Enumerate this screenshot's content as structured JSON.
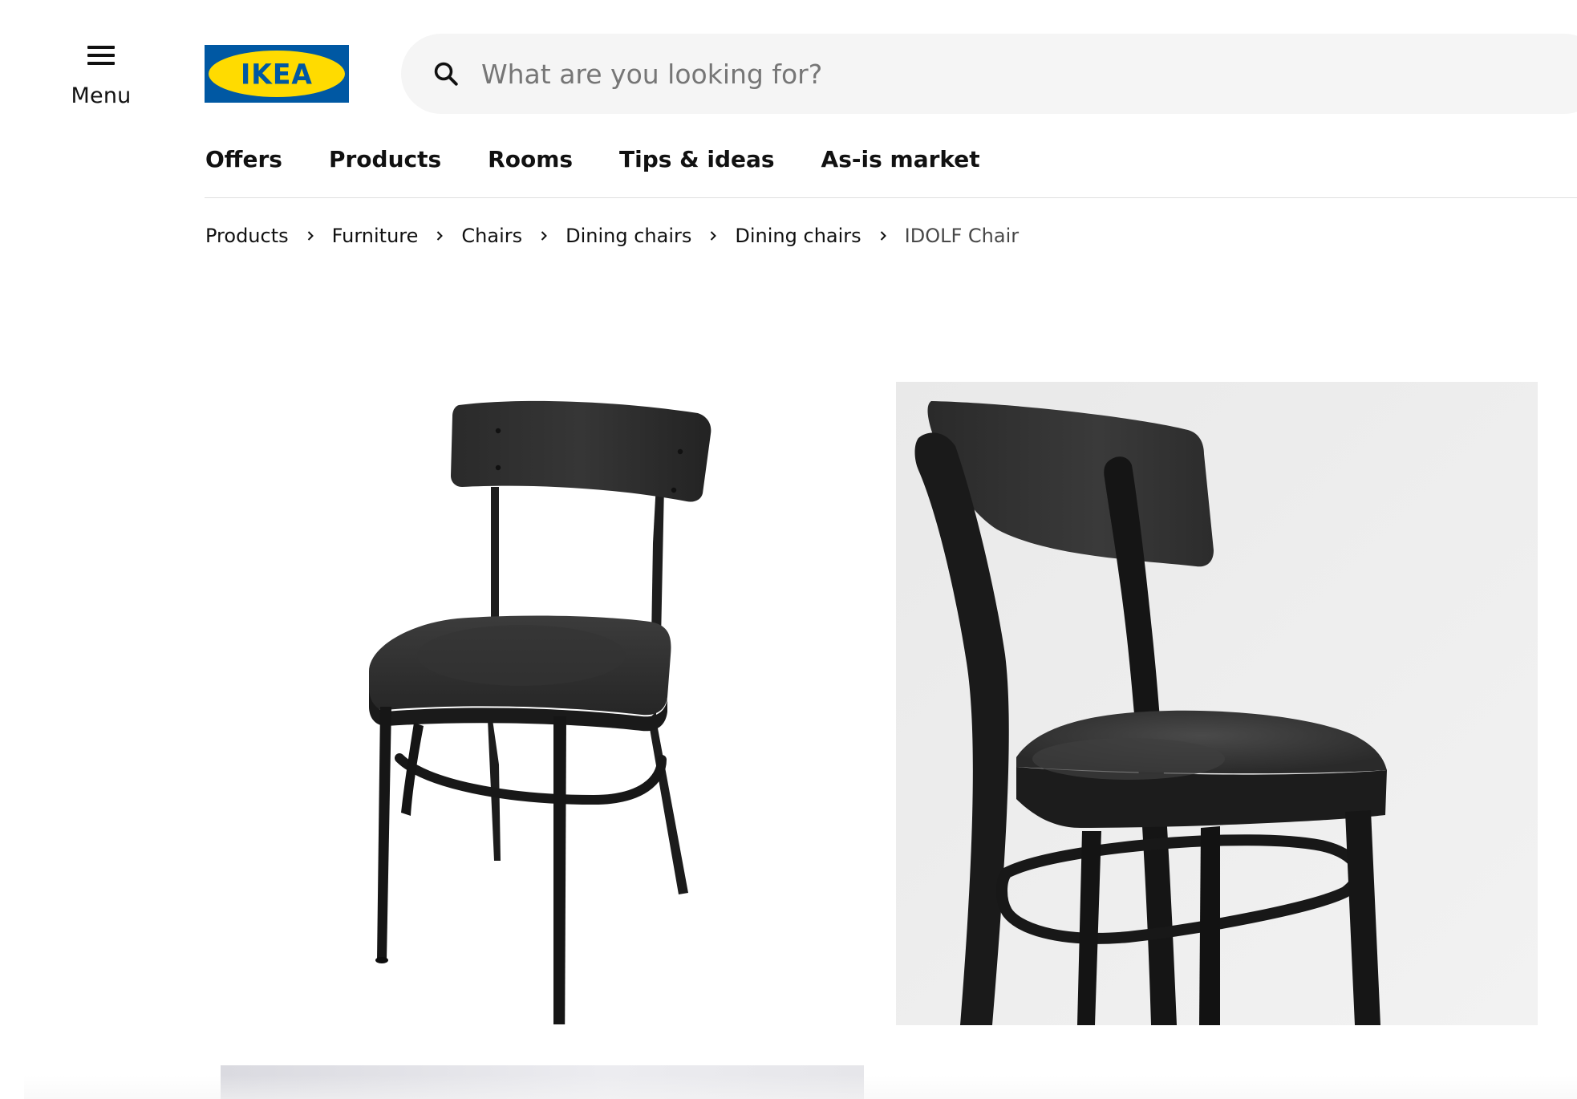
{
  "header": {
    "menu_label": "Menu",
    "logo_text": "IKEA",
    "brand_colors": {
      "blue": "#0058a3",
      "yellow": "#ffdb00"
    },
    "search": {
      "placeholder": "What are you looking for?",
      "value": ""
    }
  },
  "nav": {
    "items": [
      {
        "label": "Offers"
      },
      {
        "label": "Products"
      },
      {
        "label": "Rooms"
      },
      {
        "label": "Tips & ideas"
      },
      {
        "label": "As-is market"
      }
    ]
  },
  "breadcrumb": {
    "items": [
      {
        "label": "Products"
      },
      {
        "label": "Furniture"
      },
      {
        "label": "Chairs"
      },
      {
        "label": "Dining chairs"
      },
      {
        "label": "Dining chairs"
      }
    ],
    "current": "IDOLF Chair"
  },
  "gallery": {
    "images": [
      {
        "subject": "black-dining-chair-front-view"
      },
      {
        "subject": "black-dining-chair-back-detail"
      },
      {
        "subject": "product-photo-partial"
      }
    ]
  }
}
